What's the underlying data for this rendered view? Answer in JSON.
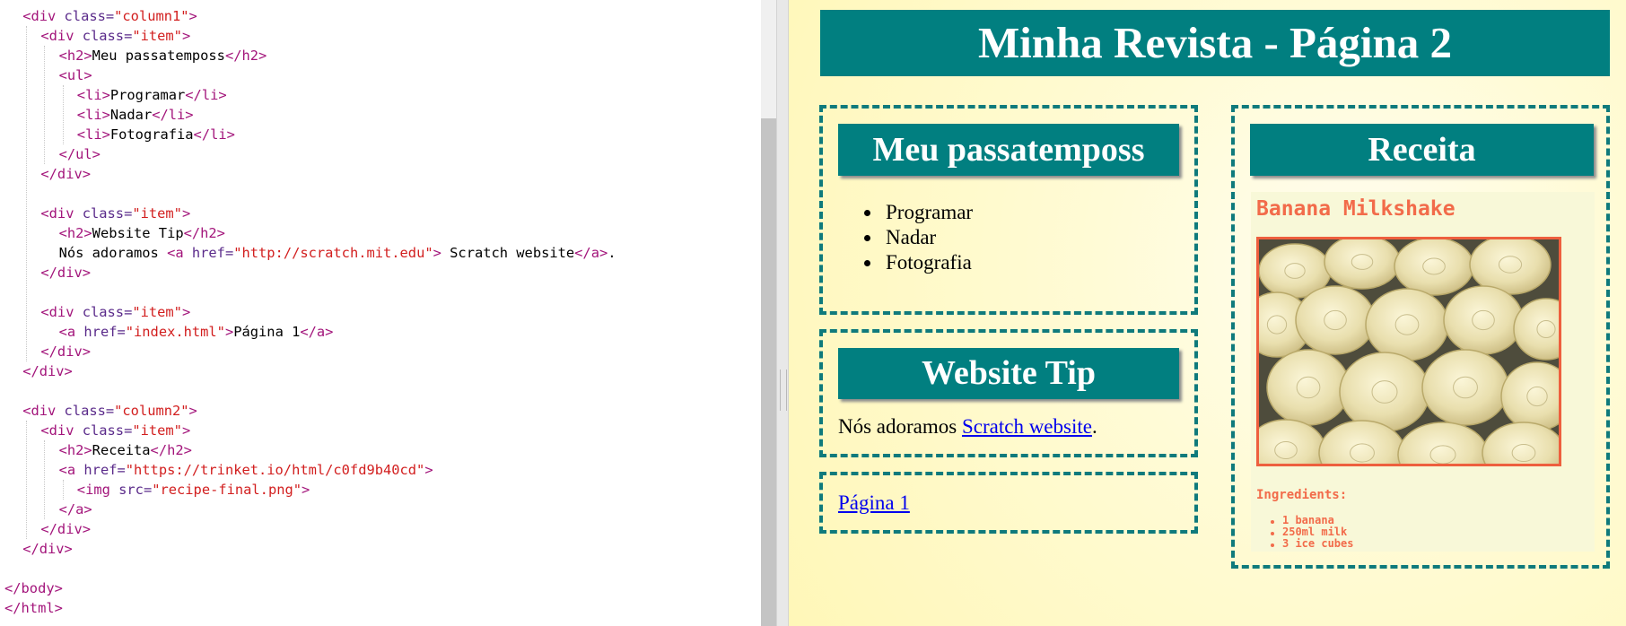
{
  "editor": {
    "lines": [
      {
        "indent": 1,
        "parts": [
          [
            "t",
            "<div "
          ],
          [
            "n",
            "class="
          ],
          [
            "v",
            "\"column1\""
          ],
          [
            "t",
            ">"
          ]
        ]
      },
      {
        "indent": 2,
        "parts": [
          [
            "t",
            "<div "
          ],
          [
            "n",
            "class="
          ],
          [
            "v",
            "\"item\""
          ],
          [
            "t",
            ">"
          ]
        ]
      },
      {
        "indent": 3,
        "parts": [
          [
            "t",
            "<h2>"
          ],
          [
            "x",
            "Meu passatemposs"
          ],
          [
            "t",
            "</h2>"
          ]
        ]
      },
      {
        "indent": 3,
        "parts": [
          [
            "t",
            "<ul>"
          ]
        ]
      },
      {
        "indent": 4,
        "parts": [
          [
            "t",
            "<li>"
          ],
          [
            "x",
            "Programar"
          ],
          [
            "t",
            "</li>"
          ]
        ]
      },
      {
        "indent": 4,
        "parts": [
          [
            "t",
            "<li>"
          ],
          [
            "x",
            "Nadar"
          ],
          [
            "t",
            "</li>"
          ]
        ]
      },
      {
        "indent": 4,
        "parts": [
          [
            "t",
            "<li>"
          ],
          [
            "x",
            "Fotografia"
          ],
          [
            "t",
            "</li>"
          ]
        ]
      },
      {
        "indent": 3,
        "parts": [
          [
            "t",
            "</ul>"
          ]
        ]
      },
      {
        "indent": 2,
        "parts": [
          [
            "t",
            "</div>"
          ]
        ]
      },
      {
        "indent": 0,
        "parts": []
      },
      {
        "indent": 2,
        "parts": [
          [
            "t",
            "<div "
          ],
          [
            "n",
            "class="
          ],
          [
            "v",
            "\"item\""
          ],
          [
            "t",
            ">"
          ]
        ]
      },
      {
        "indent": 3,
        "parts": [
          [
            "t",
            "<h2>"
          ],
          [
            "x",
            "Website Tip"
          ],
          [
            "t",
            "</h2>"
          ]
        ]
      },
      {
        "indent": 3,
        "parts": [
          [
            "x",
            "Nós adoramos "
          ],
          [
            "t",
            "<a "
          ],
          [
            "n",
            "href="
          ],
          [
            "v",
            "\"http://scratch.mit.edu\""
          ],
          [
            "t",
            ">"
          ],
          [
            "x",
            " Scratch website"
          ],
          [
            "t",
            "</a>"
          ],
          [
            "x",
            "."
          ]
        ]
      },
      {
        "indent": 2,
        "parts": [
          [
            "t",
            "</div>"
          ]
        ]
      },
      {
        "indent": 0,
        "parts": []
      },
      {
        "indent": 2,
        "parts": [
          [
            "t",
            "<div "
          ],
          [
            "n",
            "class="
          ],
          [
            "v",
            "\"item\""
          ],
          [
            "t",
            ">"
          ]
        ]
      },
      {
        "indent": 3,
        "parts": [
          [
            "t",
            "<a "
          ],
          [
            "n",
            "href="
          ],
          [
            "v",
            "\"index.html\""
          ],
          [
            "t",
            ">"
          ],
          [
            "x",
            "Página 1"
          ],
          [
            "t",
            "</a>"
          ]
        ]
      },
      {
        "indent": 2,
        "parts": [
          [
            "t",
            "</div>"
          ]
        ]
      },
      {
        "indent": 1,
        "parts": [
          [
            "t",
            "</div>"
          ]
        ]
      },
      {
        "indent": 0,
        "parts": []
      },
      {
        "indent": 1,
        "parts": [
          [
            "t",
            "<div "
          ],
          [
            "n",
            "class="
          ],
          [
            "v",
            "\"column2\""
          ],
          [
            "t",
            ">"
          ]
        ]
      },
      {
        "indent": 2,
        "parts": [
          [
            "t",
            "<div "
          ],
          [
            "n",
            "class="
          ],
          [
            "v",
            "\"item\""
          ],
          [
            "t",
            ">"
          ]
        ]
      },
      {
        "indent": 3,
        "parts": [
          [
            "t",
            "<h2>"
          ],
          [
            "x",
            "Receita"
          ],
          [
            "t",
            "</h2>"
          ]
        ]
      },
      {
        "indent": 3,
        "parts": [
          [
            "t",
            "<a "
          ],
          [
            "n",
            "href="
          ],
          [
            "v",
            "\"https://trinket.io/html/c0fd9b40cd\""
          ],
          [
            "t",
            ">"
          ]
        ]
      },
      {
        "indent": 4,
        "parts": [
          [
            "t",
            "<img "
          ],
          [
            "n",
            "src="
          ],
          [
            "v",
            "\"recipe-final.png\""
          ],
          [
            "t",
            ">"
          ]
        ]
      },
      {
        "indent": 3,
        "parts": [
          [
            "t",
            "</a>"
          ]
        ]
      },
      {
        "indent": 2,
        "parts": [
          [
            "t",
            "</div>"
          ]
        ]
      },
      {
        "indent": 1,
        "parts": [
          [
            "t",
            "</div>"
          ]
        ]
      },
      {
        "indent": 0,
        "parts": []
      },
      {
        "indent": 0,
        "parts": [
          [
            "t",
            "</body>"
          ]
        ]
      },
      {
        "indent": 0,
        "parts": [
          [
            "t",
            "</html>"
          ]
        ]
      }
    ]
  },
  "preview": {
    "banner_title": "Minha Revista - Página 2",
    "hobbies": {
      "heading": "Meu passatemposs",
      "items": [
        "Programar",
        "Nadar",
        "Fotografia"
      ]
    },
    "website_tip": {
      "heading": "Website Tip",
      "text_before": "Nós adoramos ",
      "link_text": "Scratch website",
      "text_after": "."
    },
    "page_link": "Página 1",
    "recipe": {
      "heading": "Receita",
      "title": "Banana Milkshake",
      "image_alt": "banana slices photo",
      "ingredients_label": "Ingredients:",
      "ingredients": [
        "1 banana",
        "250ml milk",
        "3 ice cubes"
      ]
    }
  },
  "colors": {
    "teal": "#017f80",
    "tag": "#a3157b",
    "attr_value": "#d21e1e",
    "recipe_orange": "#f26b4a"
  }
}
